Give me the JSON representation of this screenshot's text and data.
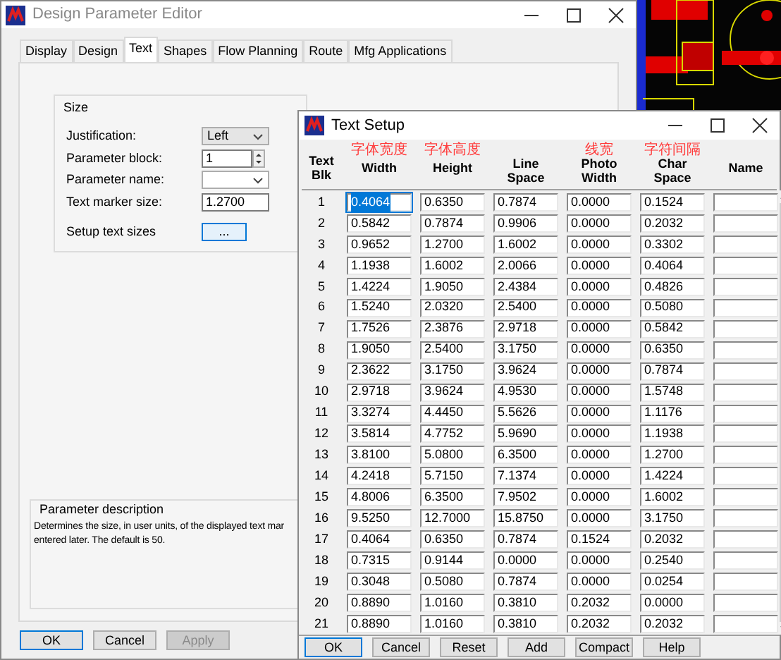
{
  "back_window": {
    "title": "Design Parameter Editor",
    "tabs": [
      {
        "label": "Display",
        "selected": false
      },
      {
        "label": "Design",
        "selected": false
      },
      {
        "label": "Text",
        "selected": true
      },
      {
        "label": "Shapes",
        "selected": false
      },
      {
        "label": "Flow Planning",
        "selected": false
      },
      {
        "label": "Route",
        "selected": false
      },
      {
        "label": "Mfg Applications",
        "selected": false
      }
    ],
    "size_group": {
      "title": "Size",
      "fields": [
        {
          "kind": "select",
          "label": "Justification:",
          "value": "Left"
        },
        {
          "kind": "spin",
          "label": "Parameter block:",
          "value": "1"
        },
        {
          "kind": "select",
          "label": "Parameter name:"
        },
        {
          "kind": "text",
          "label": "Text marker size:",
          "value": "1.2700"
        },
        {
          "kind": "button",
          "label": "Setup text sizes",
          "value": "..."
        }
      ]
    },
    "description": {
      "title": "Parameter description",
      "lines": [
        "Determines the size, in user units, of the displayed text mar",
        "entered later. The default is 50."
      ]
    },
    "buttons": [
      {
        "label": "OK",
        "default": true,
        "disabled": false
      },
      {
        "label": "Cancel",
        "default": false,
        "disabled": false
      },
      {
        "label": "Apply",
        "default": false,
        "disabled": true
      }
    ]
  },
  "text_setup": {
    "title": "Text Setup",
    "blk_header": [
      "Text",
      "Blk"
    ],
    "columns": [
      {
        "note": "字体宽度",
        "label": [
          "Width"
        ]
      },
      {
        "note": "字体高度",
        "label": [
          "Height"
        ]
      },
      {
        "label": [
          "Line",
          "Space"
        ]
      },
      {
        "note": "线宽",
        "label": [
          "Photo",
          "Width"
        ]
      },
      {
        "note": "字符间隔",
        "label": [
          "Char",
          "Space"
        ]
      },
      {
        "label": [
          "Name"
        ]
      }
    ],
    "rows": [
      {
        "blk": "1",
        "values": [
          "0.4064",
          "0.6350",
          "0.7874",
          "0.0000",
          "0.1524"
        ],
        "highlighted": true
      },
      {
        "blk": "2",
        "values": [
          "0.5842",
          "0.7874",
          "0.9906",
          "0.0000",
          "0.2032"
        ],
        "highlighted": false
      },
      {
        "blk": "3",
        "values": [
          "0.9652",
          "1.2700",
          "1.6002",
          "0.0000",
          "0.3302"
        ],
        "highlighted": false
      },
      {
        "blk": "4",
        "values": [
          "1.1938",
          "1.6002",
          "2.0066",
          "0.0000",
          "0.4064"
        ],
        "highlighted": false
      },
      {
        "blk": "5",
        "values": [
          "1.4224",
          "1.9050",
          "2.4384",
          "0.0000",
          "0.4826"
        ],
        "highlighted": false
      },
      {
        "blk": "6",
        "values": [
          "1.5240",
          "2.0320",
          "2.5400",
          "0.0000",
          "0.5080"
        ],
        "highlighted": false
      },
      {
        "blk": "7",
        "values": [
          "1.7526",
          "2.3876",
          "2.9718",
          "0.0000",
          "0.5842"
        ],
        "highlighted": false
      },
      {
        "blk": "8",
        "values": [
          "1.9050",
          "2.5400",
          "3.1750",
          "0.0000",
          "0.6350"
        ],
        "highlighted": false
      },
      {
        "blk": "9",
        "values": [
          "2.3622",
          "3.1750",
          "3.9624",
          "0.0000",
          "0.7874"
        ],
        "highlighted": false
      },
      {
        "blk": "10",
        "values": [
          "2.9718",
          "3.9624",
          "4.9530",
          "0.0000",
          "1.5748"
        ],
        "highlighted": false
      },
      {
        "blk": "11",
        "values": [
          "3.3274",
          "4.4450",
          "5.5626",
          "0.0000",
          "1.1176"
        ],
        "highlighted": false
      },
      {
        "blk": "12",
        "values": [
          "3.5814",
          "4.7752",
          "5.9690",
          "0.0000",
          "1.1938"
        ],
        "highlighted": false
      },
      {
        "blk": "13",
        "values": [
          "3.8100",
          "5.0800",
          "6.3500",
          "0.0000",
          "1.2700"
        ],
        "highlighted": false
      },
      {
        "blk": "14",
        "values": [
          "4.2418",
          "5.7150",
          "7.1374",
          "0.0000",
          "1.4224"
        ],
        "highlighted": false
      },
      {
        "blk": "15",
        "values": [
          "4.8006",
          "6.3500",
          "7.9502",
          "0.0000",
          "1.6002"
        ],
        "highlighted": false
      },
      {
        "blk": "16",
        "values": [
          "9.5250",
          "12.7000",
          "15.8750",
          "0.0000",
          "3.1750"
        ],
        "highlighted": false
      },
      {
        "blk": "17",
        "values": [
          "0.4064",
          "0.6350",
          "0.7874",
          "0.1524",
          "0.2032"
        ],
        "highlighted": false
      },
      {
        "blk": "18",
        "values": [
          "0.7315",
          "0.9144",
          "0.0000",
          "0.0000",
          "0.2540"
        ],
        "highlighted": false
      },
      {
        "blk": "19",
        "values": [
          "0.3048",
          "0.5080",
          "0.7874",
          "0.0000",
          "0.0254"
        ],
        "highlighted": false
      },
      {
        "blk": "20",
        "values": [
          "0.8890",
          "1.0160",
          "0.3810",
          "0.2032",
          "0.0000"
        ],
        "highlighted": false
      },
      {
        "blk": "21",
        "values": [
          "0.8890",
          "1.0160",
          "0.3810",
          "0.2032",
          "0.2032"
        ],
        "highlighted": false
      }
    ],
    "buttons": [
      {
        "label": "OK",
        "default": true
      },
      {
        "label": "Cancel",
        "default": false
      },
      {
        "label": "Reset",
        "default": false
      },
      {
        "label": "Add",
        "default": false
      },
      {
        "label": "Compact",
        "default": false
      },
      {
        "label": "Help",
        "default": false
      }
    ]
  }
}
